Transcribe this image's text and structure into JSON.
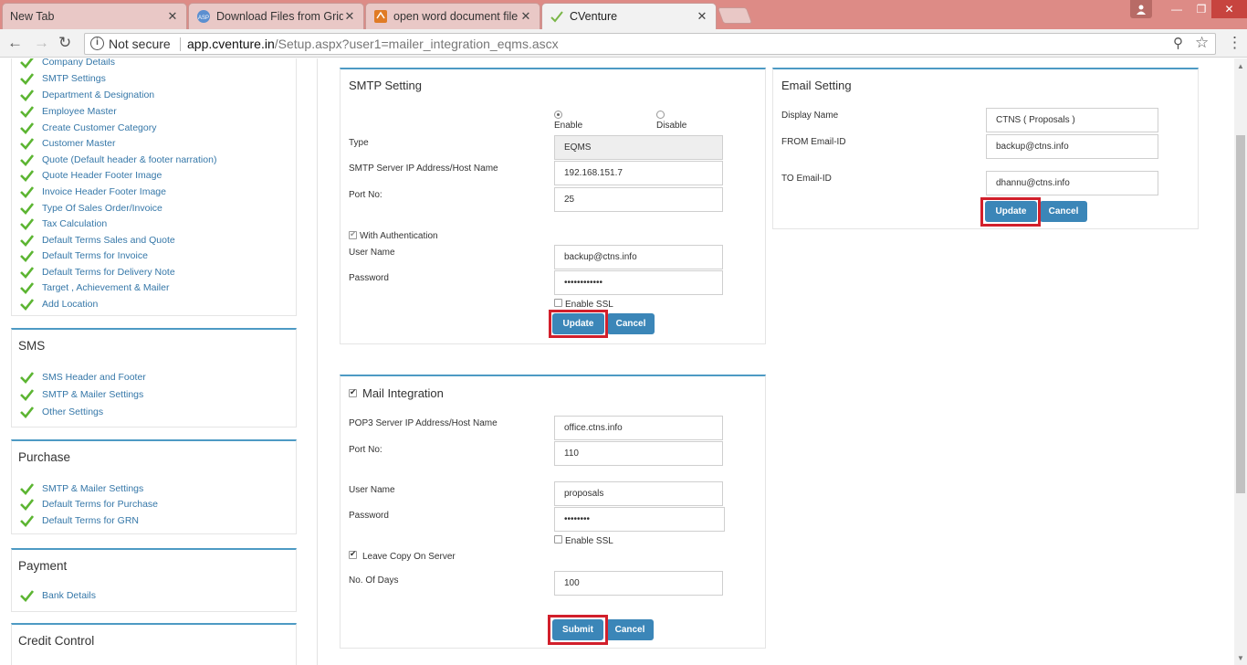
{
  "tabs": [
    {
      "label": "New Tab",
      "active": false
    },
    {
      "label": "Download Files from Grid",
      "active": false
    },
    {
      "label": "open word document file",
      "active": false
    },
    {
      "label": "CVenture",
      "active": true
    }
  ],
  "address_bar": {
    "security": "Not secure",
    "host": "app.cventure.in",
    "path": "/Setup.aspx?user1=mailer_integration_eqms.ascx"
  },
  "sidebar": {
    "company_items": [
      "Company Details",
      "SMTP Settings",
      "Department & Designation",
      "Employee Master",
      "Create Customer Category",
      "Customer Master",
      "Quote (Default header & footer narration)",
      "Quote Header Footer Image",
      "Invoice Header Footer Image",
      "Type Of Sales Order/Invoice",
      "Tax Calculation",
      "Default Terms Sales and Quote",
      "Default Terms for Invoice",
      "Default Terms for Delivery Note",
      "Target , Achievement & Mailer",
      "Add Location"
    ],
    "sms": {
      "title": "SMS",
      "items": [
        "SMS Header and Footer",
        "SMTP & Mailer Settings",
        "Other Settings"
      ]
    },
    "purchase": {
      "title": "Purchase",
      "items": [
        "SMTP & Mailer Settings",
        "Default Terms for Purchase",
        "Default Terms for GRN"
      ]
    },
    "payment": {
      "title": "Payment",
      "items": [
        "Bank Details"
      ]
    },
    "credit": {
      "title": "Credit Control"
    }
  },
  "smtp": {
    "title": "SMTP Setting",
    "enable_label": "Enable",
    "disable_label": "Disable",
    "type_label": "Type",
    "type_value": "EQMS",
    "host_label": "SMTP Server IP Address/Host Name",
    "host_value": "192.168.151.7",
    "port_label": "Port No:",
    "port_value": "25",
    "auth_label": "With Authentication",
    "user_label": "User Name",
    "user_value": "backup@ctns.info",
    "pass_label": "Password",
    "pass_value": "••••••••••••",
    "ssl_label": "Enable SSL",
    "update_label": "Update",
    "cancel_label": "Cancel"
  },
  "email": {
    "title": "Email Setting",
    "display_label": "Display Name",
    "display_value": "CTNS ( Proposals )",
    "from_label": "FROM Email-ID",
    "from_value": "backup@ctns.info",
    "to_label": "TO Email-ID",
    "to_value": "dhannu@ctns.info",
    "update_label": "Update",
    "cancel_label": "Cancel"
  },
  "mail": {
    "title": "Mail Integration",
    "pop3_label": "POP3 Server IP Address/Host Name",
    "pop3_value": "office.ctns.info",
    "port_label": "Port No:",
    "port_value": "110",
    "user_label": "User Name",
    "user_value": "proposals",
    "pass_label": "Password",
    "pass_value": "••••••••",
    "ssl_label": "Enable SSL",
    "leave_label": "Leave Copy On Server",
    "days_label": "No. Of Days",
    "days_value": "100",
    "submit_label": "Submit",
    "cancel_label": "Cancel"
  },
  "colors": {
    "accent": "#4d9ac4",
    "button": "#3b86b8",
    "highlight": "#d21f2b",
    "link": "#3577a8",
    "check": "#5cb532"
  }
}
